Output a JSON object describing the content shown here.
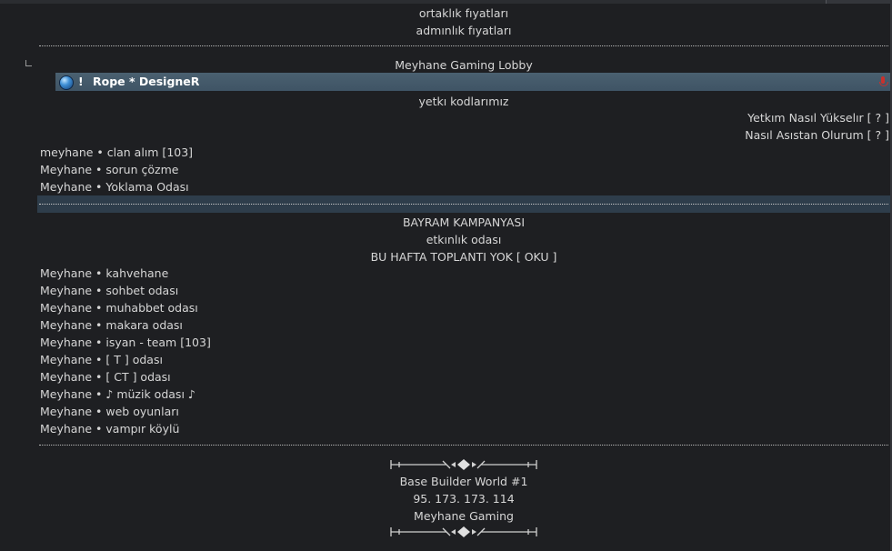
{
  "top_items": [
    "ortaklık fıyatları",
    "admınlık fıyatları"
  ],
  "lobby_channel": "Meyhane Gaming Lobby",
  "active_user": {
    "status": "!",
    "name": "Rope * DesigneR",
    "icon": "globe-icon",
    "mic_icon": "muted-mic-icon"
  },
  "codes_channel": "yetkı kodlarımız",
  "right_items": [
    "Yetkım Nasıl Yükselır [ ? ]",
    "Nasıl Asıstan Olurum [ ? ]"
  ],
  "group1": [
    "meyhane • clan alım [103]",
    "Meyhane • sorun çözme",
    "Meyhane • Yoklama Odası"
  ],
  "center_block": [
    "BAYRAM KAMPANYASI",
    "etkınlık odası",
    "BU HAFTA TOPLANTI YOK [ OKU ]"
  ],
  "group2": [
    "Meyhane • kahvehane",
    "Meyhane • sohbet odası",
    "Meyhane • muhabbet odası",
    "Meyhane • makara odası",
    "Meyhane • isyan - team [103]",
    "Meyhane • [ T ] odası",
    "Meyhane • [ CT ] odası",
    "Meyhane • ♪ müzik odası ♪",
    "Meyhane • web oyunları",
    "Meyhane • vampır köylü"
  ],
  "footer": [
    "Base Builder World #1",
    "95. 173. 173. 114",
    "Meyhane Gaming"
  ],
  "colors": {
    "background": "#1e1f22",
    "text": "#d6d6d6",
    "user_bar": "#3f5465",
    "highlight_bar": "#2e3d4b",
    "muted": "#c9302c"
  }
}
